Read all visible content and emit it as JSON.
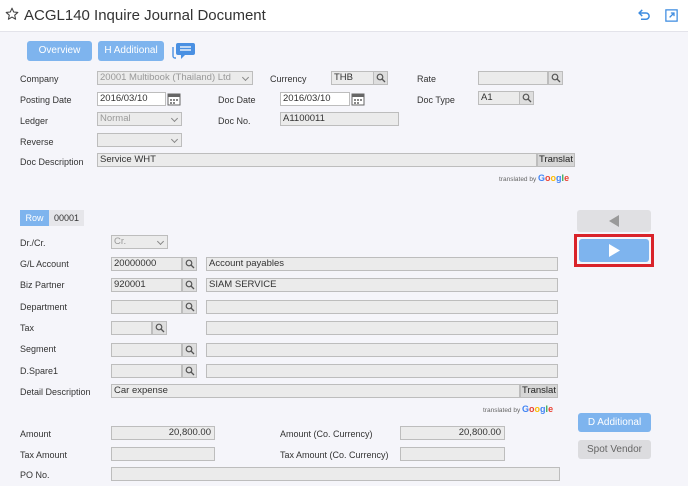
{
  "header": {
    "title": "ACGL140 Inquire Journal Document"
  },
  "toolbar": {
    "overview_label": "Overview",
    "h_additional_label": "H Additional"
  },
  "doc_header": {
    "company_label": "Company",
    "company_value": "20001 Multibook (Thailand) Ltd",
    "currency_label": "Currency",
    "currency_value": "THB",
    "rate_label": "Rate",
    "rate_value": "",
    "posting_date_label": "Posting Date",
    "posting_date_value": "2016/03/10",
    "doc_date_label": "Doc Date",
    "doc_date_value": "2016/03/10",
    "doc_type_label": "Doc Type",
    "doc_type_value": "A1",
    "ledger_label": "Ledger",
    "ledger_value": "Normal",
    "doc_no_label": "Doc No.",
    "doc_no_value": "A1100011",
    "reverse_label": "Reverse",
    "reverse_value": "",
    "doc_description_label": "Doc Description",
    "doc_description_value": "Service WHT",
    "translate_label": "Translat",
    "translated_by": "translated by",
    "google": "Google"
  },
  "detail": {
    "row_label": "Row",
    "row_value": "00001",
    "drcr_label": "Dr./Cr.",
    "drcr_value": "Cr.",
    "gl_account_label": "G/L Account",
    "gl_account_value": "20000000",
    "gl_account_name": "Account payables",
    "biz_partner_label": "Biz Partner",
    "biz_partner_value": "920001",
    "biz_partner_name": "SIAM SERVICE",
    "department_label": "Department",
    "tax_label": "Tax",
    "segment_label": "Segment",
    "dspare1_label": "D.Spare1",
    "detail_description_label": "Detail Description",
    "detail_description_value": "Car expense",
    "translate_label": "Translat",
    "translated_by": "translated by",
    "google": "Google",
    "amount_label": "Amount",
    "amount_value": "20,800.00",
    "amount_co_label": "Amount (Co. Currency)",
    "amount_co_value": "20,800.00",
    "tax_amount_label": "Tax Amount",
    "tax_amount_co_label": "Tax Amount (Co. Currency)",
    "po_no_label": "PO No.",
    "d_additional_label": "D Additional",
    "spot_vendor_label": "Spot Vendor"
  },
  "colors": {
    "accent": "#7eb4ee",
    "highlight_border": "#d9232a",
    "google_blue": "#4285f4",
    "google_red": "#ea4335",
    "google_yellow": "#fbbc05",
    "google_green": "#34a853"
  }
}
